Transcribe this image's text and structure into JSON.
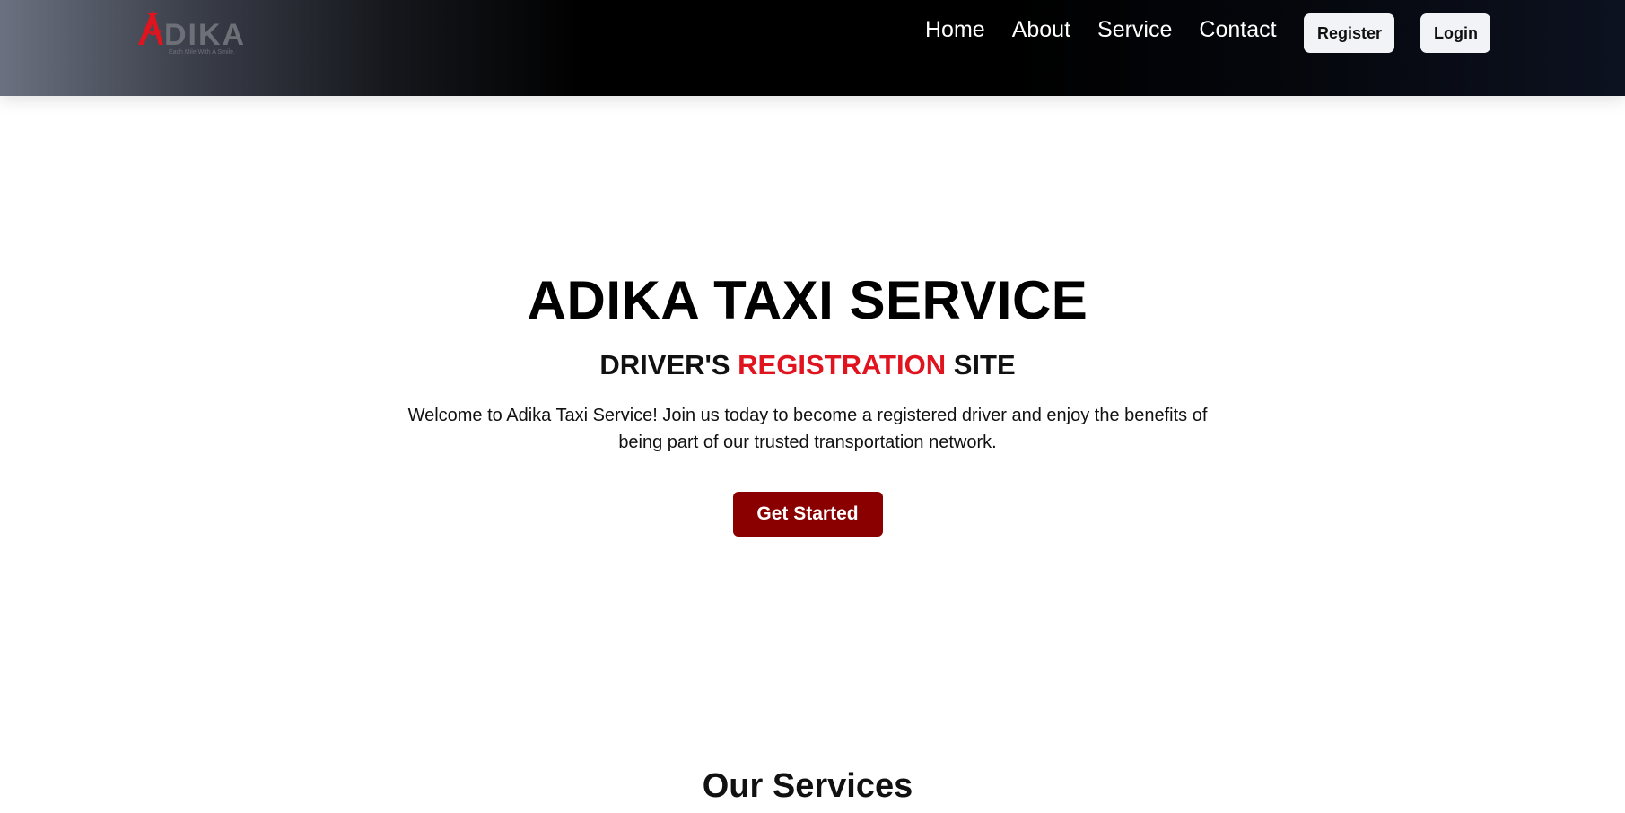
{
  "header": {
    "logo": {
      "text": "ADIKA",
      "tagline": "Each Mile With A Smile.",
      "colors": {
        "accent": "#e0141e",
        "text": "#6e7077"
      }
    },
    "nav": [
      {
        "label": "Home"
      },
      {
        "label": "About"
      },
      {
        "label": "Service"
      },
      {
        "label": "Contact"
      }
    ],
    "register_label": "Register",
    "login_label": "Login"
  },
  "hero": {
    "title": "ADIKA TAXI SERVICE",
    "subtitle_prefix": "DRIVER'S ",
    "subtitle_accent": "REGISTRATION",
    "subtitle_suffix": " SITE",
    "description": "Welcome to Adika Taxi Service! Join us today to become a registered driver and enjoy the benefits of being part of our trusted transportation network.",
    "cta_label": "Get Started"
  },
  "services": {
    "title": "Our Services"
  },
  "colors": {
    "accent_red": "#e0141e",
    "cta_bg": "#8a0000",
    "button_bg": "#f2f3f6"
  }
}
